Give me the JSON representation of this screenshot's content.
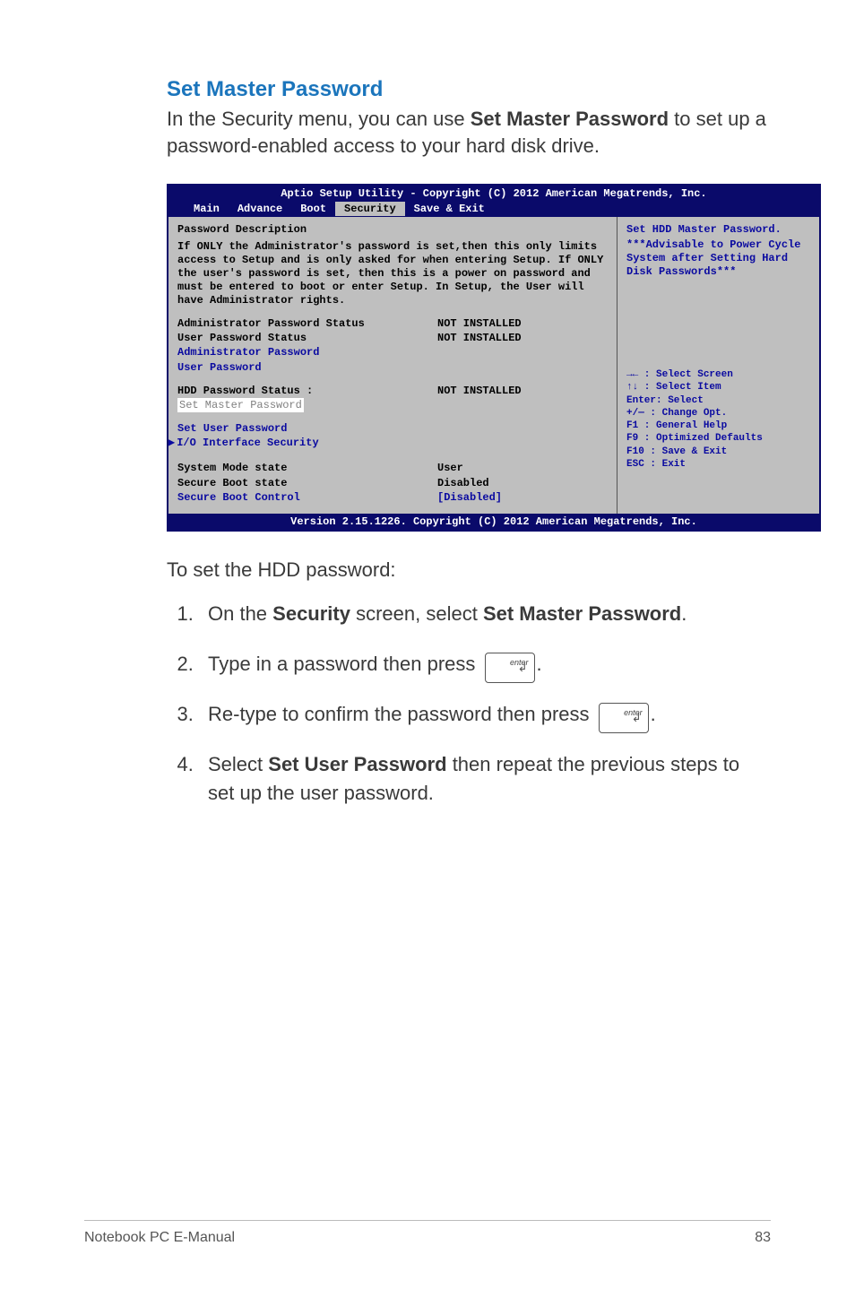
{
  "heading": "Set Master Password",
  "intro_pre": "In the Security menu, you can use ",
  "intro_bold": "Set Master Password",
  "intro_post": " to set up a password-enabled access to your hard disk drive.",
  "bios": {
    "title": "Aptio Setup Utility - Copyright (C) 2012 American Megatrends, Inc.",
    "tabs": {
      "t1": "Main",
      "t2": "Advance",
      "t3": "Boot",
      "t4": "Security",
      "t5": "Save & Exit"
    },
    "pd_title": "Password Description",
    "pd_desc": "If ONLY the Administrator's password is set,then this only limits access to Setup and is only asked for when entering Setup. If ONLY the user's password is set, then this is a power on password and must be entered to boot or enter Setup. In Setup, the User will have Administrator rights.",
    "rows": {
      "admin_status_lbl": "Administrator Password Status",
      "admin_status_val": "NOT INSTALLED",
      "user_status_lbl": "User Password Status",
      "user_status_val": "NOT INSTALLED",
      "admin_pw": "Administrator Password",
      "user_pw": "User Password",
      "hdd_status_lbl": "HDD Password Status :",
      "hdd_status_val": "NOT INSTALLED",
      "set_master": "Set Master Password",
      "set_user": "Set User Password",
      "io_sec": "I/O Interface Security",
      "sys_mode_lbl": "System Mode state",
      "sys_mode_val": "User",
      "sec_boot_lbl": "Secure Boot state",
      "sec_boot_val": "Disabled",
      "sec_boot_ctrl_lbl": "Secure Boot Control",
      "sec_boot_ctrl_val": "[Disabled]"
    },
    "help": {
      "title": "Set HDD Master Password.",
      "text": "***Advisable  to  Power Cycle System after Setting Hard Disk Passwords***"
    },
    "keys": {
      "k1": "→←  : Select Screen",
      "k2": "↑↓   : Select Item",
      "k3": "Enter: Select",
      "k4": "+/—  : Change Opt.",
      "k5": "F1   : General Help",
      "k6": "F9   : Optimized Defaults",
      "k7": "F10  : Save & Exit",
      "k8": "ESC  : Exit"
    },
    "footer": "Version 2.15.1226. Copyright (C) 2012 American Megatrends, Inc."
  },
  "subhead": "To set the HDD password:",
  "steps": {
    "s1_pre": "On the ",
    "s1_b1": "Security",
    "s1_mid": " screen, select ",
    "s1_b2": "Set Master Password",
    "s1_post": ".",
    "s2_pre": "Type in a password then press ",
    "s2_post": ".",
    "s3_pre": "Re-type to confirm the password then press ",
    "s3_post": ".",
    "s4_pre": "Select ",
    "s4_b": "Set User Password",
    "s4_post": " then repeat the previous steps to set up the user password."
  },
  "key_label": "enter",
  "footer": {
    "left": "Notebook PC E-Manual",
    "right": "83"
  }
}
